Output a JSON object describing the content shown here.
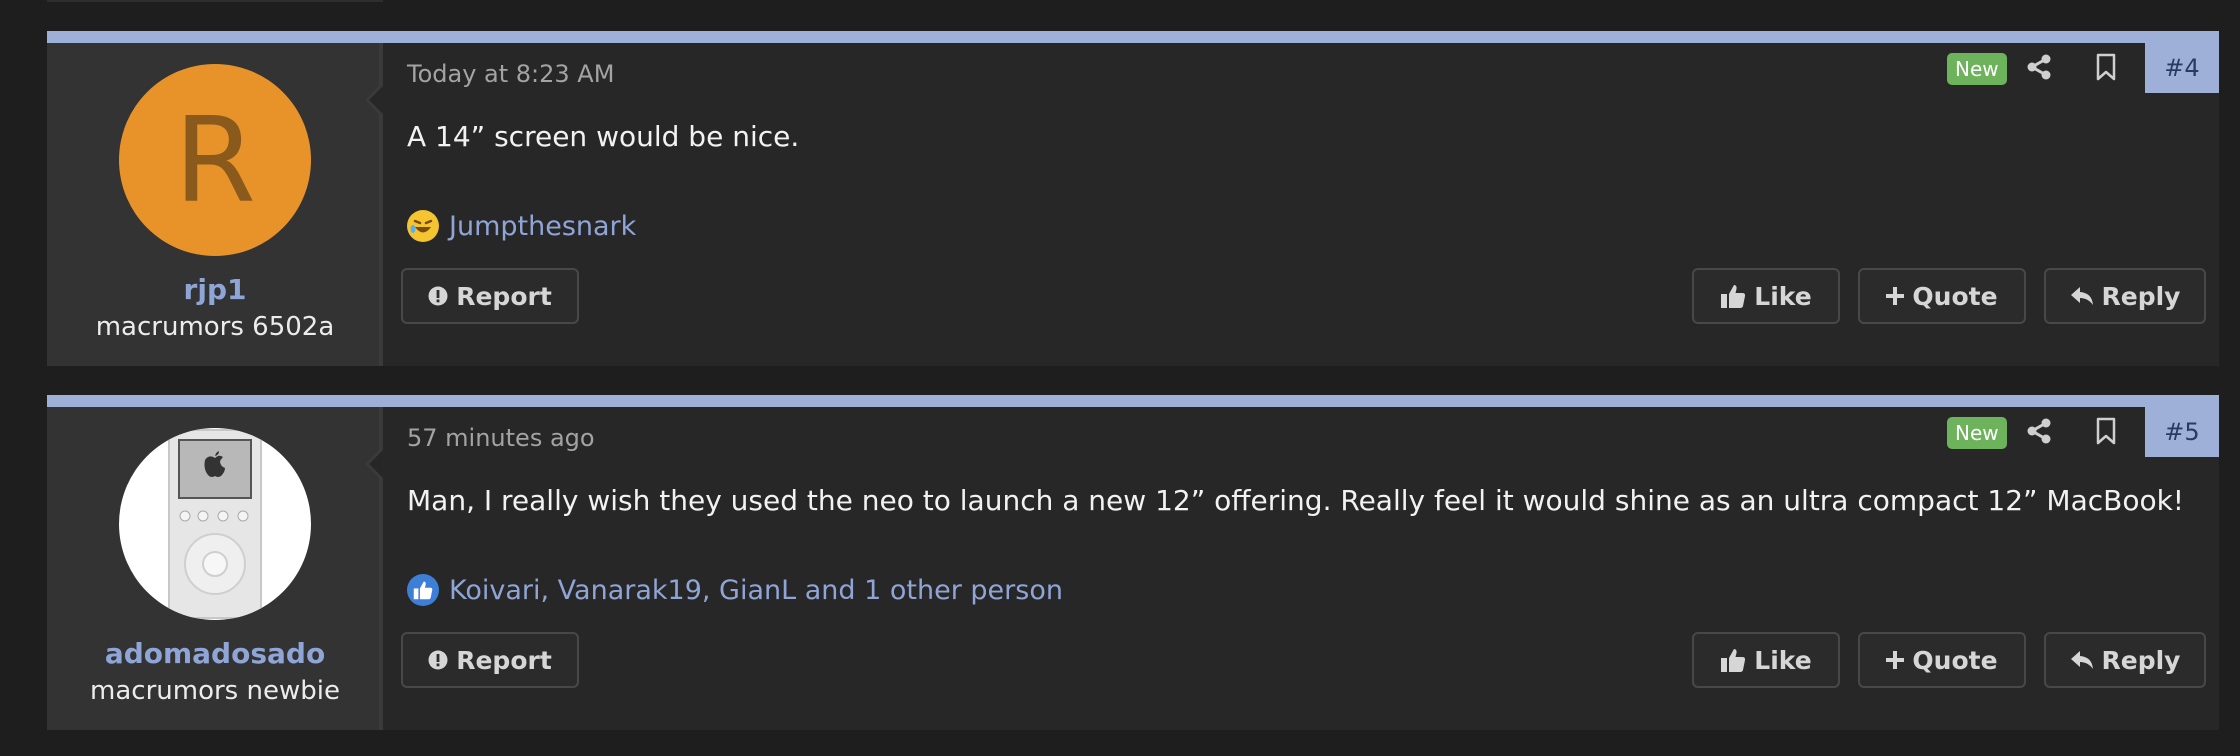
{
  "posts": [
    {
      "timestamp": "Today at 8:23 AM",
      "badge": "New",
      "number": "#4",
      "author": {
        "name": "rjp1",
        "title": "macrumors 6502a",
        "avatar_letter": "R",
        "avatar_color": "#e8932a"
      },
      "message": "A 14” screen would be nice.",
      "reaction": {
        "icon": "laughing-emoji-icon",
        "text": "Jumpthesnark"
      },
      "actions": {
        "report": "Report",
        "like": "Like",
        "quote": "Quote",
        "reply": "Reply"
      }
    },
    {
      "timestamp": "57 minutes ago",
      "badge": "New",
      "number": "#5",
      "author": {
        "name": "adomadosado",
        "title": "macrumors newbie",
        "avatar_image": "ipod-classic"
      },
      "message": "Man, I really wish they used the neo to launch a new 12” offering. Really feel it would shine as an ultra compact 12” MacBook!",
      "reaction": {
        "icon": "thumbs-up-reaction-icon",
        "text": "Koivari, Vanarak19, GianL and 1 other person"
      },
      "actions": {
        "report": "Report",
        "like": "Like",
        "quote": "Quote",
        "reply": "Reply"
      }
    }
  ],
  "colors": {
    "accent": "#9fb0d8",
    "badge_new": "#6db35b",
    "link": "#8fa5d6",
    "background": "#1e1e1e",
    "post_bg": "#272727",
    "user_col_bg": "#333333"
  }
}
